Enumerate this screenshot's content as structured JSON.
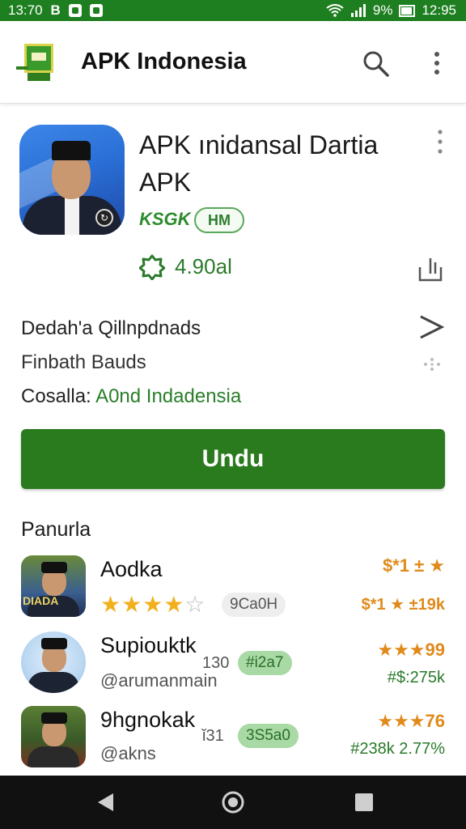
{
  "status_bar": {
    "left_time": "13:70",
    "left_letter": "B",
    "right_text": "9%",
    "time": "12:95"
  },
  "app_bar": {
    "title": "APK Indonesia"
  },
  "app": {
    "name": "APK ınidansal Dartia APK",
    "dev_tag": "KSGK",
    "pill": "HM",
    "rating": "4.90al",
    "details": {
      "line1": "Dedah'a Qillnpdnads",
      "line2": "Finbath Bauds",
      "line3_label": "Cosalla:",
      "line3_value": "A0nd Indadensia"
    },
    "download_label": "Undu"
  },
  "section": {
    "title": "Panurla"
  },
  "list": [
    {
      "title": "Aodka",
      "stars": 4,
      "chip": "9Ca0H",
      "right_top": "$*1 ± ★",
      "right_bottom": "$*1 ★ ±19k",
      "thumb_label": "DIADA"
    },
    {
      "title": "Supiouktk",
      "sub": "@arumanmain",
      "num": "130",
      "chip": "#i2a7",
      "right_top": "★★★99",
      "right_bottom": "#$:275k"
    },
    {
      "title": "9hgnokak",
      "sub": "@akns",
      "num": "ǐ31",
      "chip": "3S5a0",
      "right_top": "★★★76",
      "right_bottom": "#238k 2.77%"
    }
  ],
  "colors": {
    "brand_green": "#2a7a1e",
    "status_green": "#1d7f1f",
    "star": "#f2b01e"
  }
}
